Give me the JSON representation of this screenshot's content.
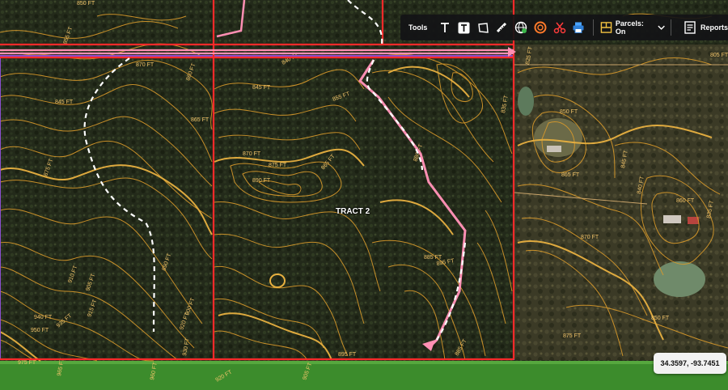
{
  "toolbar": {
    "tools_label": "Tools",
    "parcels_label": "Parcels: On",
    "reports_label": "Reports",
    "icons": [
      "text-icon",
      "text-box-icon",
      "polygon-icon",
      "ruler-icon",
      "globe-icon",
      "radius-icon",
      "scissors-icon",
      "print-icon"
    ]
  },
  "tract_label": "TRACT 2",
  "coordinates": "34.3597, -93.7451",
  "contours": [
    "850 FT",
    "845 FT",
    "855 FT",
    "870 FT",
    "840 FT",
    "865 FT",
    "875 FT",
    "885 FT",
    "890 FT",
    "880 FT",
    "895 FT",
    "910 FT",
    "905 FT",
    "915 FT",
    "920 FT",
    "930 FT",
    "935 FT",
    "940 FT",
    "950 FT",
    "960 FT",
    "965 FT",
    "975 FT",
    "825 FT",
    "805 FT",
    "860 FT",
    "835 FT"
  ],
  "colors": {
    "contour": "#d99a2b",
    "boundary": "#ff2a2a",
    "route": "#ff8fb3",
    "parcel": "#8a4fd0",
    "trail": "#ffffff",
    "field": "#3c8c2c"
  }
}
